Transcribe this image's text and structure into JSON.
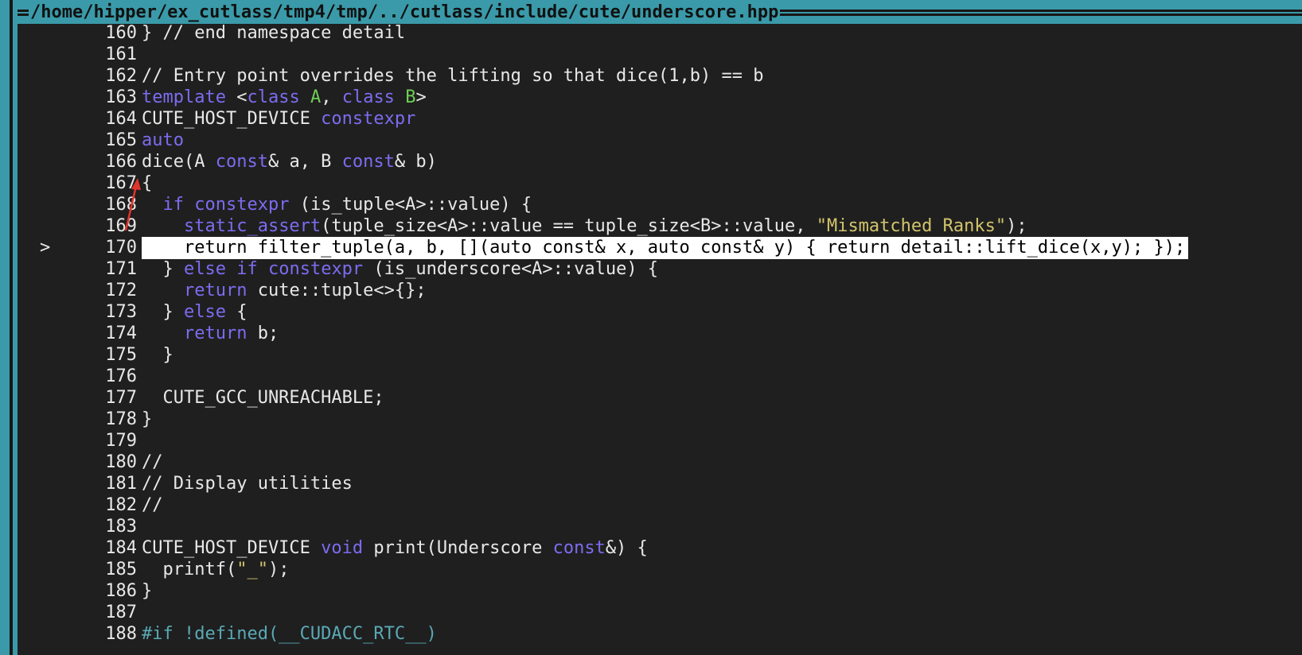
{
  "window": {
    "file_path": "/home/hipper/ex_cutlass/tmp4/tmp/../cutlass/include/cute/underscore.hpp"
  },
  "colors": {
    "border": "#3a9aa9",
    "background": "#1f1f1f",
    "keyword": "#7c6cf0",
    "type_param": "#6fcf55",
    "string": "#d2c46b",
    "current_line_bg": "#ffffff",
    "annotation_arrow": "#e0352b"
  },
  "editor": {
    "current_line_marker": ">",
    "current_line": 170,
    "lines": [
      {
        "num": "160",
        "text": "} // end namespace detail"
      },
      {
        "num": "161",
        "text": ""
      },
      {
        "num": "162",
        "text": "// Entry point overrides the lifting so that dice(1,b) == b"
      },
      {
        "num": "163",
        "text": "template <class A, class B>"
      },
      {
        "num": "164",
        "text": "CUTE_HOST_DEVICE constexpr"
      },
      {
        "num": "165",
        "text": "auto"
      },
      {
        "num": "166",
        "text": "dice(A const& a, B const& b)"
      },
      {
        "num": "167",
        "text": "{"
      },
      {
        "num": "168",
        "text": "  if constexpr (is_tuple<A>::value) {"
      },
      {
        "num": "169",
        "text": "    static_assert(tuple_size<A>::value == tuple_size<B>::value, \"Mismatched Ranks\");"
      },
      {
        "num": "170",
        "text": "    return filter_tuple(a, b, [](auto const& x, auto const& y) { return detail::lift_dice(x,y); });"
      },
      {
        "num": "171",
        "text": "  } else if constexpr (is_underscore<A>::value) {"
      },
      {
        "num": "172",
        "text": "    return cute::tuple<>{};"
      },
      {
        "num": "173",
        "text": "  } else {"
      },
      {
        "num": "174",
        "text": "    return b;"
      },
      {
        "num": "175",
        "text": "  }"
      },
      {
        "num": "176",
        "text": ""
      },
      {
        "num": "177",
        "text": "  CUTE_GCC_UNREACHABLE;"
      },
      {
        "num": "178",
        "text": "}"
      },
      {
        "num": "179",
        "text": ""
      },
      {
        "num": "180",
        "text": "//"
      },
      {
        "num": "181",
        "text": "// Display utilities"
      },
      {
        "num": "182",
        "text": "//"
      },
      {
        "num": "183",
        "text": ""
      },
      {
        "num": "184",
        "text": "CUTE_HOST_DEVICE void print(Underscore const&) {"
      },
      {
        "num": "185",
        "text": "  printf(\"_\");"
      },
      {
        "num": "186",
        "text": "}"
      },
      {
        "num": "187",
        "text": ""
      },
      {
        "num": "188",
        "text": "#if !defined(__CUDACC_RTC__)"
      }
    ]
  }
}
